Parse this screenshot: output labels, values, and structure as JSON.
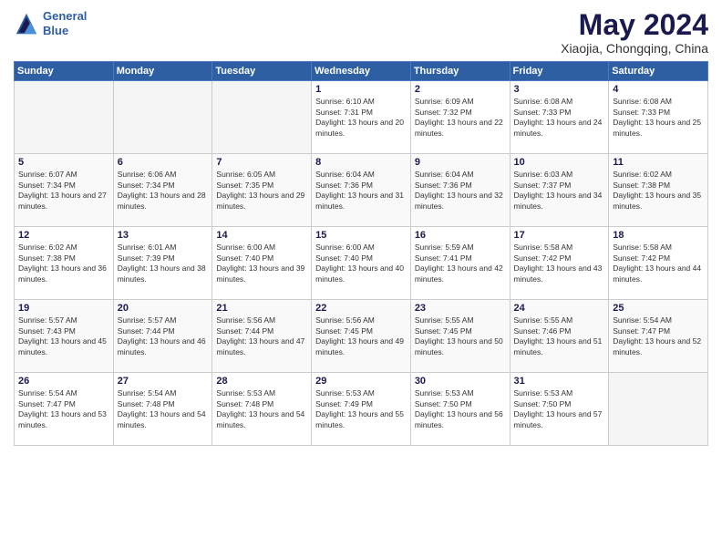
{
  "header": {
    "logo_line1": "General",
    "logo_line2": "Blue",
    "title": "May 2024",
    "subtitle": "Xiaojia, Chongqing, China"
  },
  "weekdays": [
    "Sunday",
    "Monday",
    "Tuesday",
    "Wednesday",
    "Thursday",
    "Friday",
    "Saturday"
  ],
  "weeks": [
    [
      {
        "day": "",
        "empty": true
      },
      {
        "day": "",
        "empty": true
      },
      {
        "day": "",
        "empty": true
      },
      {
        "day": "1",
        "sunrise": "6:10 AM",
        "sunset": "7:31 PM",
        "daylight": "13 hours and 20 minutes."
      },
      {
        "day": "2",
        "sunrise": "6:09 AM",
        "sunset": "7:32 PM",
        "daylight": "13 hours and 22 minutes."
      },
      {
        "day": "3",
        "sunrise": "6:08 AM",
        "sunset": "7:33 PM",
        "daylight": "13 hours and 24 minutes."
      },
      {
        "day": "4",
        "sunrise": "6:08 AM",
        "sunset": "7:33 PM",
        "daylight": "13 hours and 25 minutes."
      }
    ],
    [
      {
        "day": "5",
        "sunrise": "6:07 AM",
        "sunset": "7:34 PM",
        "daylight": "13 hours and 27 minutes."
      },
      {
        "day": "6",
        "sunrise": "6:06 AM",
        "sunset": "7:34 PM",
        "daylight": "13 hours and 28 minutes."
      },
      {
        "day": "7",
        "sunrise": "6:05 AM",
        "sunset": "7:35 PM",
        "daylight": "13 hours and 29 minutes."
      },
      {
        "day": "8",
        "sunrise": "6:04 AM",
        "sunset": "7:36 PM",
        "daylight": "13 hours and 31 minutes."
      },
      {
        "day": "9",
        "sunrise": "6:04 AM",
        "sunset": "7:36 PM",
        "daylight": "13 hours and 32 minutes."
      },
      {
        "day": "10",
        "sunrise": "6:03 AM",
        "sunset": "7:37 PM",
        "daylight": "13 hours and 34 minutes."
      },
      {
        "day": "11",
        "sunrise": "6:02 AM",
        "sunset": "7:38 PM",
        "daylight": "13 hours and 35 minutes."
      }
    ],
    [
      {
        "day": "12",
        "sunrise": "6:02 AM",
        "sunset": "7:38 PM",
        "daylight": "13 hours and 36 minutes."
      },
      {
        "day": "13",
        "sunrise": "6:01 AM",
        "sunset": "7:39 PM",
        "daylight": "13 hours and 38 minutes."
      },
      {
        "day": "14",
        "sunrise": "6:00 AM",
        "sunset": "7:40 PM",
        "daylight": "13 hours and 39 minutes."
      },
      {
        "day": "15",
        "sunrise": "6:00 AM",
        "sunset": "7:40 PM",
        "daylight": "13 hours and 40 minutes."
      },
      {
        "day": "16",
        "sunrise": "5:59 AM",
        "sunset": "7:41 PM",
        "daylight": "13 hours and 42 minutes."
      },
      {
        "day": "17",
        "sunrise": "5:58 AM",
        "sunset": "7:42 PM",
        "daylight": "13 hours and 43 minutes."
      },
      {
        "day": "18",
        "sunrise": "5:58 AM",
        "sunset": "7:42 PM",
        "daylight": "13 hours and 44 minutes."
      }
    ],
    [
      {
        "day": "19",
        "sunrise": "5:57 AM",
        "sunset": "7:43 PM",
        "daylight": "13 hours and 45 minutes."
      },
      {
        "day": "20",
        "sunrise": "5:57 AM",
        "sunset": "7:44 PM",
        "daylight": "13 hours and 46 minutes."
      },
      {
        "day": "21",
        "sunrise": "5:56 AM",
        "sunset": "7:44 PM",
        "daylight": "13 hours and 47 minutes."
      },
      {
        "day": "22",
        "sunrise": "5:56 AM",
        "sunset": "7:45 PM",
        "daylight": "13 hours and 49 minutes."
      },
      {
        "day": "23",
        "sunrise": "5:55 AM",
        "sunset": "7:45 PM",
        "daylight": "13 hours and 50 minutes."
      },
      {
        "day": "24",
        "sunrise": "5:55 AM",
        "sunset": "7:46 PM",
        "daylight": "13 hours and 51 minutes."
      },
      {
        "day": "25",
        "sunrise": "5:54 AM",
        "sunset": "7:47 PM",
        "daylight": "13 hours and 52 minutes."
      }
    ],
    [
      {
        "day": "26",
        "sunrise": "5:54 AM",
        "sunset": "7:47 PM",
        "daylight": "13 hours and 53 minutes."
      },
      {
        "day": "27",
        "sunrise": "5:54 AM",
        "sunset": "7:48 PM",
        "daylight": "13 hours and 54 minutes."
      },
      {
        "day": "28",
        "sunrise": "5:53 AM",
        "sunset": "7:48 PM",
        "daylight": "13 hours and 54 minutes."
      },
      {
        "day": "29",
        "sunrise": "5:53 AM",
        "sunset": "7:49 PM",
        "daylight": "13 hours and 55 minutes."
      },
      {
        "day": "30",
        "sunrise": "5:53 AM",
        "sunset": "7:50 PM",
        "daylight": "13 hours and 56 minutes."
      },
      {
        "day": "31",
        "sunrise": "5:53 AM",
        "sunset": "7:50 PM",
        "daylight": "13 hours and 57 minutes."
      },
      {
        "day": "",
        "empty": true
      }
    ]
  ]
}
